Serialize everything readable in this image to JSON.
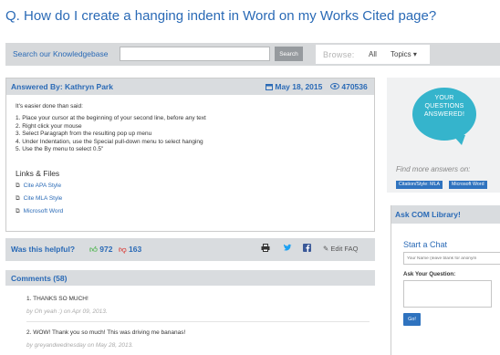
{
  "page": {
    "title": "Q. How do I create a hanging indent in Word on my Works Cited page?"
  },
  "search": {
    "label": "Search our Knowledgebase",
    "input_value": "",
    "button_label": "Search",
    "browse_label": "Browse:",
    "all_label": "All",
    "topics_label": "Topics"
  },
  "answer": {
    "answered_by": "Answered By: Kathryn Park",
    "date": "May 18, 2015",
    "views": "470536",
    "intro": "It's easier done than said:",
    "steps": [
      "1. Place your cursor at the beginning of your second line, before any text",
      "2. Right click your mouse",
      "3. Select Paragraph from the resulting pop up menu",
      "4. Under Indentation, use the Special pull-down menu to select hanging",
      "5. Use the By menu to select 0.5\""
    ],
    "links_title": "Links & Files",
    "links": [
      "Cite APA Style",
      "Cite MLA Style",
      "Microsoft Word"
    ]
  },
  "helpful": {
    "label": "Was this helpful?",
    "up_count": "972",
    "down_count": "163",
    "edit_label": "Edit FAQ"
  },
  "comments": {
    "title": "Comments (58)",
    "items": [
      {
        "text": "1. THANKS SO MUCH!",
        "byline": "by Oh yeah :) on Apr 09, 2013."
      },
      {
        "text": "2. WOW! Thank you so much! This was driving me bananas!",
        "byline": "by greyandwednesday on May 28, 2013."
      }
    ]
  },
  "sidebar": {
    "bubble_lines": [
      "YOUR",
      "QUESTIONS",
      "ANSWERED!"
    ],
    "find_more": "Find more answers on:",
    "tags": [
      "Citation/Style: MLA",
      "Microsoft Word"
    ]
  },
  "ask": {
    "title": "Ask COM Library!",
    "chat_title": "Start a Chat",
    "name_placeholder": "Your Name (leave blank for anonym",
    "question_label": "Ask Your Question:",
    "question_value": "",
    "go_label": "Go!"
  },
  "colors": {
    "link_blue": "#2a6ab6",
    "bar_gray": "#d9dcdf",
    "bubble_teal": "#35b4cc",
    "tag_blue": "#2f73bf",
    "thumb_up_green": "#5cb85c",
    "thumb_down_red": "#d9534f"
  },
  "icons": [
    "calendar-icon",
    "eye-icon",
    "external-link-icon",
    "thumbs-up-icon",
    "thumbs-down-icon",
    "print-icon",
    "twitter-icon",
    "facebook-icon",
    "edit-icon",
    "chevron-down-icon"
  ]
}
